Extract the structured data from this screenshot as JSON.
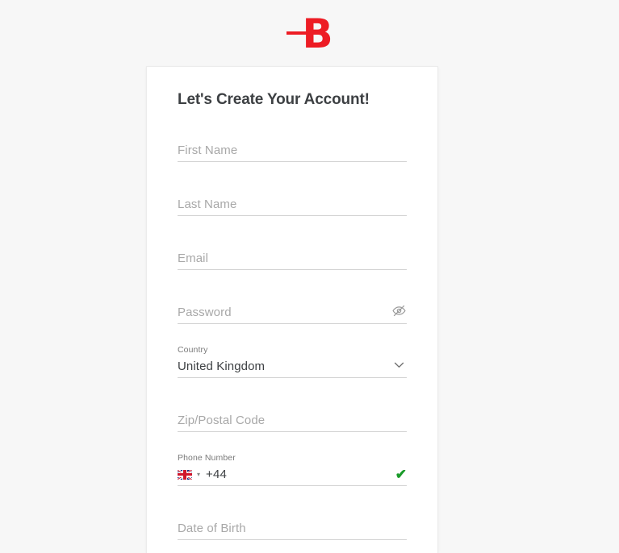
{
  "brand": {
    "logo_letter": "B",
    "logo_icon": "brand-logo-b",
    "logo_color": "#ed1c24"
  },
  "card": {
    "title": "Let's Create Your Account!",
    "fields": [
      {
        "name": "first-name",
        "placeholder": "First Name",
        "value": "",
        "label": "",
        "icon": ""
      },
      {
        "name": "last-name",
        "placeholder": "Last Name",
        "value": "",
        "label": "",
        "icon": ""
      },
      {
        "name": "email",
        "placeholder": "Email",
        "value": "",
        "label": "",
        "icon": ""
      },
      {
        "name": "password",
        "placeholder": "Password",
        "value": "",
        "label": "",
        "icon": "eye-off-icon"
      },
      {
        "name": "country",
        "placeholder": "",
        "value": "United Kingdom",
        "label": "Country",
        "icon": "chevron-down-icon"
      },
      {
        "name": "zip-postal-code",
        "placeholder": "Zip/Postal Code",
        "value": "",
        "label": "",
        "icon": ""
      },
      {
        "name": "phone-number",
        "placeholder": "",
        "value": "+44",
        "label": "Phone Number",
        "icon": "check-icon"
      },
      {
        "name": "date-of-birth",
        "placeholder": "Date of Birth",
        "value": "",
        "label": "",
        "icon": ""
      }
    ],
    "password_toggle_label": "eye-off-icon",
    "country_selected": "United Kingdom",
    "phone": {
      "label": "Phone Number",
      "flag": "uk-flag-icon",
      "flag_country": "United Kingdom",
      "dial_code": "+44",
      "caret": "▾",
      "valid_mark": "✔"
    }
  },
  "colors": {
    "brand_red": "#ed1c24",
    "page_background": "#f7f7f7",
    "card_background": "#ffffff",
    "title_text": "#3d4043",
    "placeholder_text": "#a8a8a8",
    "underline": "#d2d2d2",
    "valid_green": "#1a9b29"
  }
}
